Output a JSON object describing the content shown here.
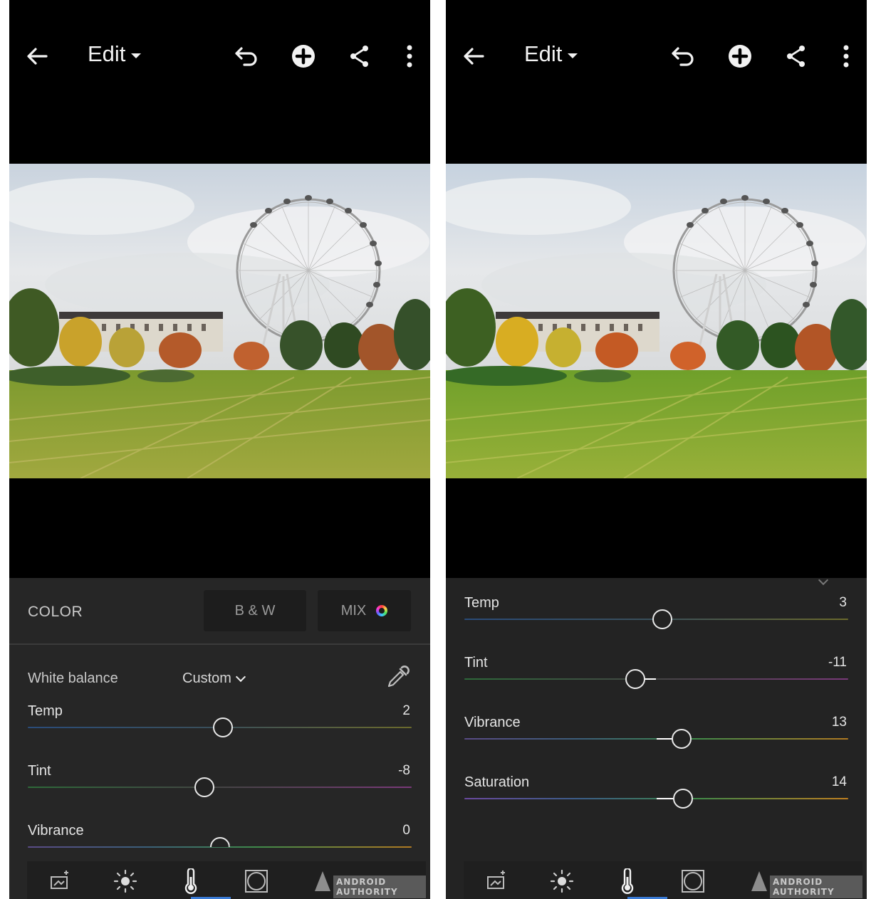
{
  "screens": [
    {
      "header": {
        "title": "Edit"
      },
      "mode_bar": {
        "section_label": "COLOR",
        "bw_label": "B & W",
        "mix_label": "MIX"
      },
      "white_balance": {
        "label": "White balance",
        "value": "Custom"
      },
      "sliders": [
        {
          "label": "Temp",
          "value": "2",
          "position": 0.508
        },
        {
          "label": "Tint",
          "value": "-8",
          "position": 0.46
        },
        {
          "label": "Vibrance",
          "value": "0",
          "position": 0.5
        }
      ],
      "watermark": "ANDROID AUTHORITY"
    },
    {
      "header": {
        "title": "Edit"
      },
      "sliders": [
        {
          "label": "Temp",
          "value": "3",
          "position": 0.515
        },
        {
          "label": "Tint",
          "value": "-11",
          "position": 0.445
        },
        {
          "label": "Vibrance",
          "value": "13",
          "position": 0.565
        },
        {
          "label": "Saturation",
          "value": "14",
          "position": 0.57
        }
      ],
      "watermark": "ANDROID AUTHORITY"
    }
  ],
  "icons": {
    "back": "arrow-left-icon",
    "undo": "undo-icon",
    "add": "plus-circle-icon",
    "share": "share-icon",
    "more": "more-vertical-icon",
    "eyedropper": "eyedropper-icon",
    "tools": [
      "presets-icon",
      "light-icon",
      "color-thermometer-icon",
      "effects-vignette-icon",
      "detail-icon"
    ]
  },
  "colors": {
    "background": "#000000",
    "panel": "#262626",
    "accent": "#3a7bd5"
  }
}
